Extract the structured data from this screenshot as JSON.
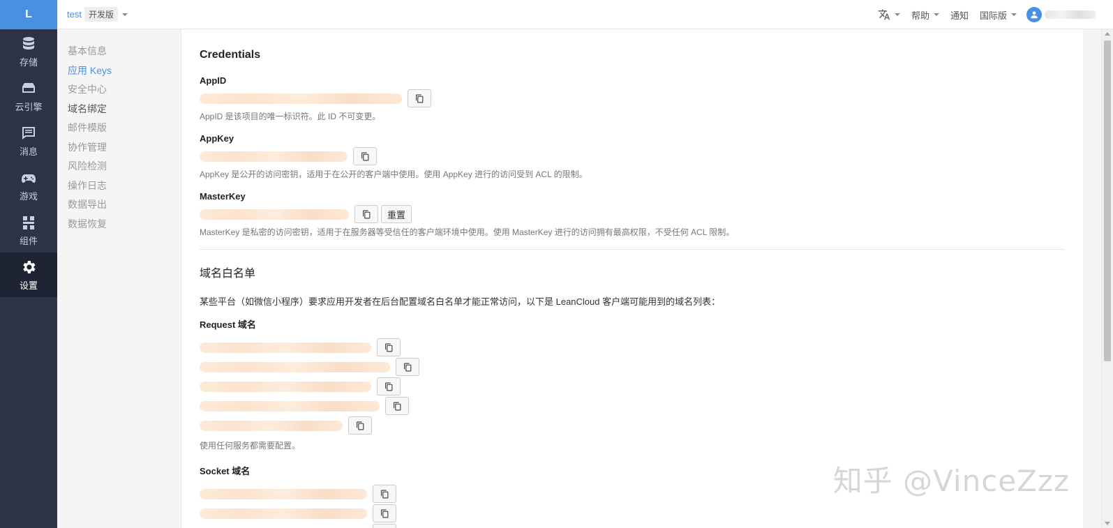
{
  "logo": "L",
  "nav": [
    {
      "label": "存储",
      "icon": "database-icon"
    },
    {
      "label": "云引擎",
      "icon": "server-icon"
    },
    {
      "label": "消息",
      "icon": "message-icon"
    },
    {
      "label": "游戏",
      "icon": "gamepad-icon"
    },
    {
      "label": "组件",
      "icon": "component-icon"
    },
    {
      "label": "设置",
      "icon": "gear-icon",
      "active": true
    }
  ],
  "topbar": {
    "app_name": "test",
    "env": "开发版",
    "help": "帮助",
    "notify": "通知",
    "region": "国际版"
  },
  "subnav": [
    {
      "label": "基本信息"
    },
    {
      "label": "应用 Keys",
      "active": true
    },
    {
      "label": "安全中心"
    },
    {
      "label": "域名绑定"
    },
    {
      "label": "邮件模版"
    },
    {
      "label": "协作管理"
    },
    {
      "label": "风险检测"
    },
    {
      "label": "操作日志"
    },
    {
      "label": "数据导出"
    },
    {
      "label": "数据恢复"
    }
  ],
  "credentials": {
    "title": "Credentials",
    "appid_label": "AppID",
    "appid_help": "AppID 是该项目的唯一标识符。此 ID 不可变更。",
    "appkey_label": "AppKey",
    "appkey_help": "AppKey 是公开的访问密钥，适用于在公开的客户端中使用。使用 AppKey 进行的访问受到 ACL 的限制。",
    "masterkey_label": "MasterKey",
    "reset_label": "重置",
    "masterkey_help": "MasterKey 是私密的访问密钥，适用于在服务器等受信任的客户端环境中使用。使用 MasterKey 进行的访问拥有最高权限，不受任何 ACL 限制。"
  },
  "whitelist": {
    "title": "域名白名单",
    "description": "某些平台（如微信小程序）要求应用开发者在后台配置域名白名单才能正常访问，以下是 LeanCloud 客户端可能用到的域名列表：",
    "request_label": "Request 域名",
    "request_help": "使用任何服务都需要配置。",
    "socket_label": "Socket 域名"
  },
  "watermark": "知乎 @VinceZzz"
}
